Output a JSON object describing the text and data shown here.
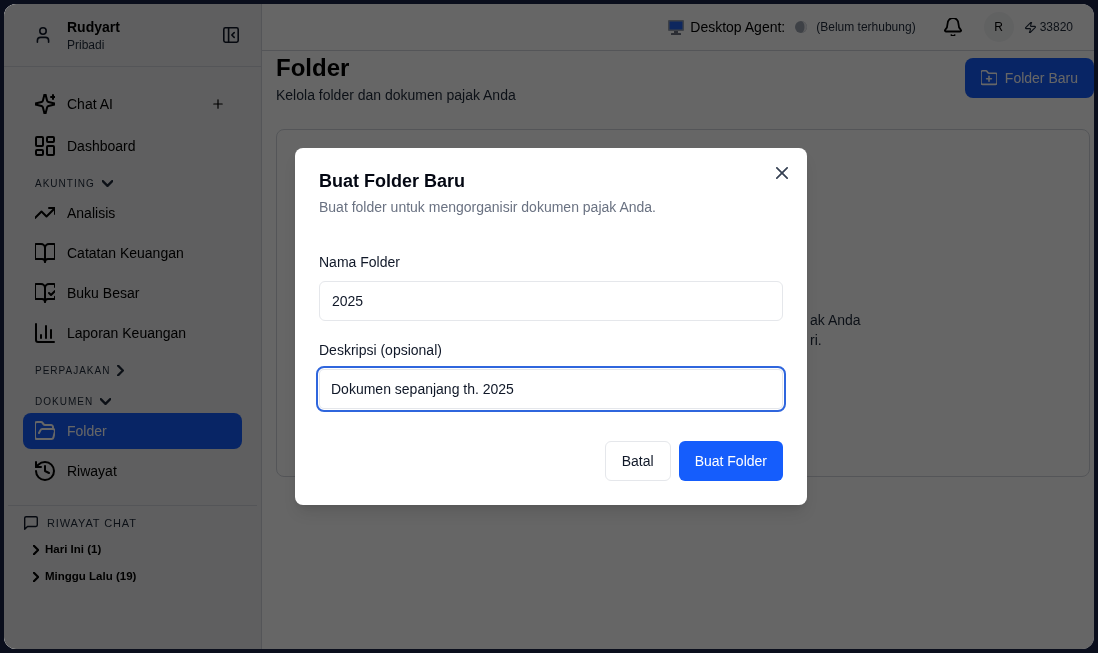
{
  "sidebar": {
    "user": {
      "name": "Rudyart",
      "subtitle": "Pribadi"
    },
    "nav": [
      {
        "kind": "link",
        "label": "Chat AI",
        "selected": false,
        "add_button": true
      },
      {
        "kind": "link",
        "label": "Dashboard",
        "selected": false
      },
      {
        "kind": "section",
        "label": "AKUNTING",
        "expanded": true,
        "items": [
          {
            "label": "Analisis",
            "selected": false
          },
          {
            "label": "Catatan Keuangan",
            "selected": false
          },
          {
            "label": "Buku Besar",
            "selected": false
          },
          {
            "label": "Laporan Keuangan",
            "selected": false
          }
        ]
      },
      {
        "kind": "section",
        "label": "PERPAJAKAN",
        "expanded": false
      },
      {
        "kind": "section",
        "label": "DOKUMEN",
        "expanded": true,
        "items": [
          {
            "label": "Folder",
            "selected": true
          },
          {
            "label": "Riwayat",
            "selected": false
          }
        ]
      }
    ],
    "chat_history": {
      "title": "RIWAYAT CHAT",
      "groups": [
        {
          "label": "Hari Ini (1)",
          "expanded": false
        },
        {
          "label": "Minggu Lalu (19)",
          "expanded": false
        }
      ]
    }
  },
  "top_bar": {
    "agent_label": "Desktop Agent:",
    "agent_status": "(Belum terhubung)",
    "avatar_initial": "R",
    "credits": "33820"
  },
  "page": {
    "title": "Folder",
    "subtitle": "Kelola folder dan dokumen pajak Anda",
    "new_button": "Folder Baru",
    "card_text": [
      "ak Anda",
      "ri."
    ]
  },
  "dialog": {
    "title": "Buat Folder Baru",
    "description": "Buat folder untuk mengorganisir dokumen pajak Anda.",
    "fields": [
      {
        "label": "Nama Folder",
        "value": "2025",
        "focused": false
      },
      {
        "label": "Deskripsi (opsional)",
        "value": "Dokumen sepanjang th. 2025",
        "focused": true
      }
    ],
    "buttons": [
      {
        "kind": "secondary",
        "label": "Batal"
      },
      {
        "kind": "primary",
        "label": "Buat Folder"
      }
    ]
  }
}
